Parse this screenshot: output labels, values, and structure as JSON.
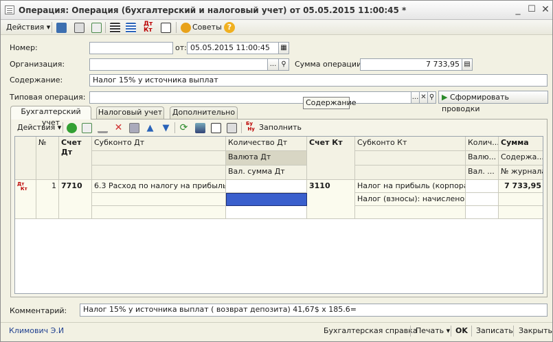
{
  "window": {
    "title": "Операция: Операция (бухгалтерский и налоговый учет)  от 05.05.2015 11:00:45 *"
  },
  "toolbar": {
    "actions_label": "Действия",
    "tips_label": "Советы"
  },
  "form": {
    "number_label": "Номер:",
    "number_value": "",
    "date_from_label": "от:",
    "date_value": "05.05.2015 11:00:45",
    "org_label": "Организация:",
    "org_value": "",
    "sum_label": "Сумма операции:",
    "sum_value": "7 733,95",
    "content_label": "Содержание:",
    "content_value": "Налог 15% у источника выплат",
    "typical_label": "Типовая операция:",
    "typical_value": "",
    "generate_button": "Сформировать проводки",
    "dots": "..."
  },
  "tooltip": "Содержание",
  "tabs": [
    "Бухгалтерский учет",
    "Налоговый учет",
    "Дополнительно"
  ],
  "grid_toolbar": {
    "actions_label": "Действия",
    "fill_label": "Заполнить"
  },
  "grid": {
    "headers": {
      "num": "№",
      "debit_account": "Счет Дт",
      "debit_subconto": "Субконто Дт",
      "debit_qty": "Количество Дт",
      "debit_currency": "Валюта Дт",
      "debit_cur_sum": "Вал. сумма Дт",
      "credit_account": "Счет Кт",
      "credit_subconto": "Субконто Кт",
      "credit_qty": "Колич...",
      "credit_currency": "Валю...",
      "credit_cur_sum": "Вал. ...",
      "sum": "Сумма",
      "content": "Содержа...",
      "journal": "№ журнала"
    },
    "rows": [
      {
        "icon_text_top": "Дт",
        "icon_text_bottom": "Кт",
        "num": "1",
        "debit_account": "7710",
        "debit_subconto1": "6.3 Расход по налогу на прибыль",
        "credit_account": "3110",
        "credit_subconto1": "Налог на прибыль (корпора...",
        "credit_subconto2": "Налог (взносы): начислено ...",
        "sum": "7 733,95"
      }
    ]
  },
  "comment": {
    "label": "Комментарий:",
    "value": "Налог 15% у источника выплат ( возврат депозита) 41,67$ x 185.6="
  },
  "status": {
    "user": "Климович Э.И",
    "accounting_ref": "Бухгалтерская справка",
    "print": "Печать",
    "ok": "OK",
    "save": "Записать",
    "close": "Закрыть"
  }
}
